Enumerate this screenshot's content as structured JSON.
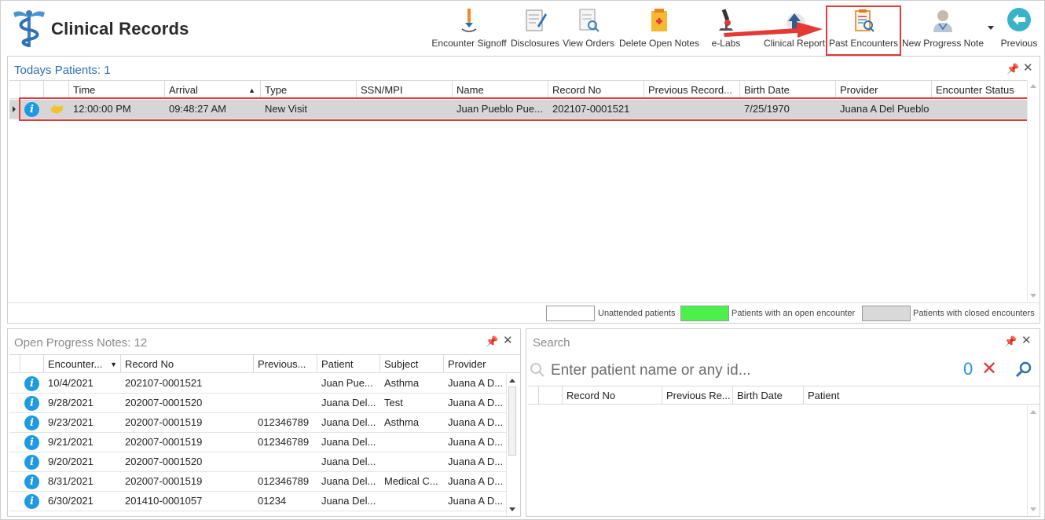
{
  "app": {
    "title": "Clinical Records"
  },
  "toolbar": {
    "items": [
      {
        "id": "encounter-signoff",
        "label": "Encounter Signoff"
      },
      {
        "id": "disclosures",
        "label": "Disclosures"
      },
      {
        "id": "view-orders",
        "label": "View Orders"
      },
      {
        "id": "delete-open-notes",
        "label": "Delete Open Notes"
      },
      {
        "id": "e-labs",
        "label": "e-Labs"
      },
      {
        "id": "clinical-report",
        "label": "Clinical Report"
      },
      {
        "id": "past-encounters",
        "label": "Past Encounters"
      },
      {
        "id": "new-progress-note",
        "label": "New Progress Note"
      },
      {
        "id": "previous",
        "label": "Previous"
      }
    ],
    "highlighted": "Past Encounters"
  },
  "todays_patients": {
    "title_label": "Todays Patients:",
    "count": "1",
    "pin_icon": "pin-icon",
    "close_icon": "close-icon",
    "columns": [
      "Time",
      "Arrival",
      "Type",
      "SSN/MPI",
      "Name",
      "Record No",
      "Previous Record...",
      "Birth Date",
      "Provider",
      "Encounter Status"
    ],
    "sorted_column": "Arrival",
    "rows": [
      {
        "time": "12:00:00 PM",
        "arrival": "09:48:27 AM",
        "type": "New Visit",
        "ssn": "",
        "name": "Juan Pueblo Pue...",
        "record_no": "202107-0001521",
        "previous_record": "",
        "birth_date": "7/25/1970",
        "provider": "Juana A Del Pueblo",
        "status": ""
      }
    ]
  },
  "legend": {
    "items": [
      {
        "label": "Unattended patients",
        "color": "#ffffff"
      },
      {
        "label": "Patients with an open encounter",
        "color": "#4cf04a"
      },
      {
        "label": "Patients with closed encounters",
        "color": "#d9d9d9"
      }
    ]
  },
  "open_progress_notes": {
    "title_label": "Open Progress Notes:",
    "count": "12",
    "columns": [
      "Encounter...",
      "Record No",
      "Previous...",
      "Patient",
      "Subject",
      "Provider"
    ],
    "rows": [
      {
        "encounter": "10/4/2021",
        "record_no": "202107-0001521",
        "previous": "",
        "patient": "Juan Pue...",
        "subject": "Asthma",
        "provider": "Juana A D..."
      },
      {
        "encounter": "9/28/2021",
        "record_no": "202007-0001520",
        "previous": "",
        "patient": "Juana Del...",
        "subject": "Test",
        "provider": "Juana A D..."
      },
      {
        "encounter": "9/23/2021",
        "record_no": "202007-0001519",
        "previous": "012346789",
        "patient": "Juana Del...",
        "subject": "Asthma",
        "provider": "Juana A D..."
      },
      {
        "encounter": "9/21/2021",
        "record_no": "202007-0001519",
        "previous": "012346789",
        "patient": "Juana Del...",
        "subject": "",
        "provider": "Juana A D..."
      },
      {
        "encounter": "9/20/2021",
        "record_no": "202007-0001520",
        "previous": "",
        "patient": "Juana Del...",
        "subject": "",
        "provider": "Juana A D..."
      },
      {
        "encounter": "8/31/2021",
        "record_no": "202007-0001519",
        "previous": "012346789",
        "patient": "Juana Del...",
        "subject": "Medical C...",
        "provider": "Juana A D..."
      },
      {
        "encounter": "6/30/2021",
        "record_no": "201410-0001057",
        "previous": "01234",
        "patient": "Juana Del...",
        "subject": "",
        "provider": "Juana A D..."
      }
    ]
  },
  "search": {
    "title": "Search",
    "placeholder": "Enter patient name or any id...",
    "result_count": "0",
    "columns": [
      "Record No",
      "Previous Re...",
      "Birth Date",
      "Patient"
    ]
  },
  "colors": {
    "accent_blue": "#2d6fb3",
    "highlight_red": "#e0393b",
    "info_blue": "#1e9be0",
    "selected_row": "#d6d6d6"
  }
}
